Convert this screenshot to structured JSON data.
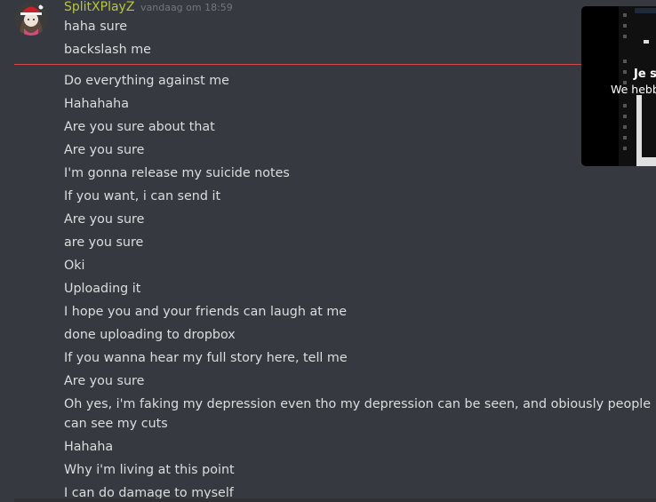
{
  "message": {
    "author": "SplitXPlayZ",
    "timestamp": "vandaag om 18:59",
    "lines_before_divider": [
      "haha sure",
      "backslash me"
    ],
    "lines_after_divider": [
      "Do everything against me",
      "Hahahaha",
      "Are you sure about that",
      "Are you sure",
      "I'm gonna release my suicide notes",
      "If you want, i can send it",
      "Are you sure",
      "are you sure",
      "Oki",
      "Uploading it",
      "I hope you and your friends can laugh at me",
      "done uploading to dropbox",
      "If you wanna hear my full story here, tell me",
      "Are you sure",
      "Oh yes, i'm faking my depression even tho my depression can be seen, and obiously people can see my cuts",
      "Hahaha",
      "Why i'm living at this point",
      "I can do damage to myself"
    ]
  },
  "preview": {
    "title": "Je s",
    "subtitle": "We hebb"
  },
  "colors": {
    "background": "#36393f",
    "username": "#b7c544",
    "text": "#dcddde",
    "timestamp": "#72767d",
    "new_divider": "#d4474a"
  }
}
